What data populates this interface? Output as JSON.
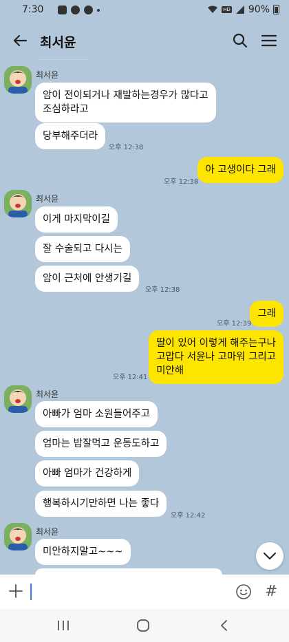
{
  "status_bar": {
    "time": "7:30",
    "battery": "90%"
  },
  "header": {
    "title": "최서윤"
  },
  "messages": {
    "g1": {
      "sender": "최서윤",
      "b1": "암이 전이되거나 재발하는경우가 많다고",
      "b1b": "조심하라고",
      "b2": "당부해주더라",
      "time": "오후 12:38"
    },
    "o1": {
      "text": "아 고생이다 그래",
      "time": "오후 12:38"
    },
    "g2": {
      "sender": "최서윤",
      "b1": "이게 마지막이길",
      "b2": "잘 수술되고 다시는",
      "b3": "암이 근처에 안생기길",
      "time": "오후 12:38"
    },
    "o2": {
      "b1": "그래",
      "time1": "오후 12:39",
      "b2a": "딸이 있어 이렇게 해주는구나",
      "b2b": "고맙다 서윤나 고마워 그리고",
      "b2c": "미안해",
      "time2": "오후 12:41"
    },
    "g3": {
      "sender": "최서윤",
      "b1": "아빠가 엄마 소원들어주고",
      "b2": "엄마는 밥잘먹고 운동도하고",
      "b3": "아빠 엄마가 건강하게",
      "b4": "행복하시기만하면 나는 좋다",
      "time": "오후 12:42"
    },
    "g4": {
      "sender": "최서윤",
      "b1": "미안하지말고~~~"
    }
  },
  "icons": {
    "back": "arrow-left-icon",
    "search": "search-icon",
    "menu": "hamburger-menu-icon",
    "plus": "plus-icon",
    "emoji": "emoji-icon",
    "hash": "hash-icon",
    "scroll_down": "chevron-down-icon"
  },
  "input": {
    "hash_symbol": "#"
  },
  "colors": {
    "background": "#b2c7da",
    "outgoing": "#fee500",
    "incoming": "#ffffff"
  }
}
